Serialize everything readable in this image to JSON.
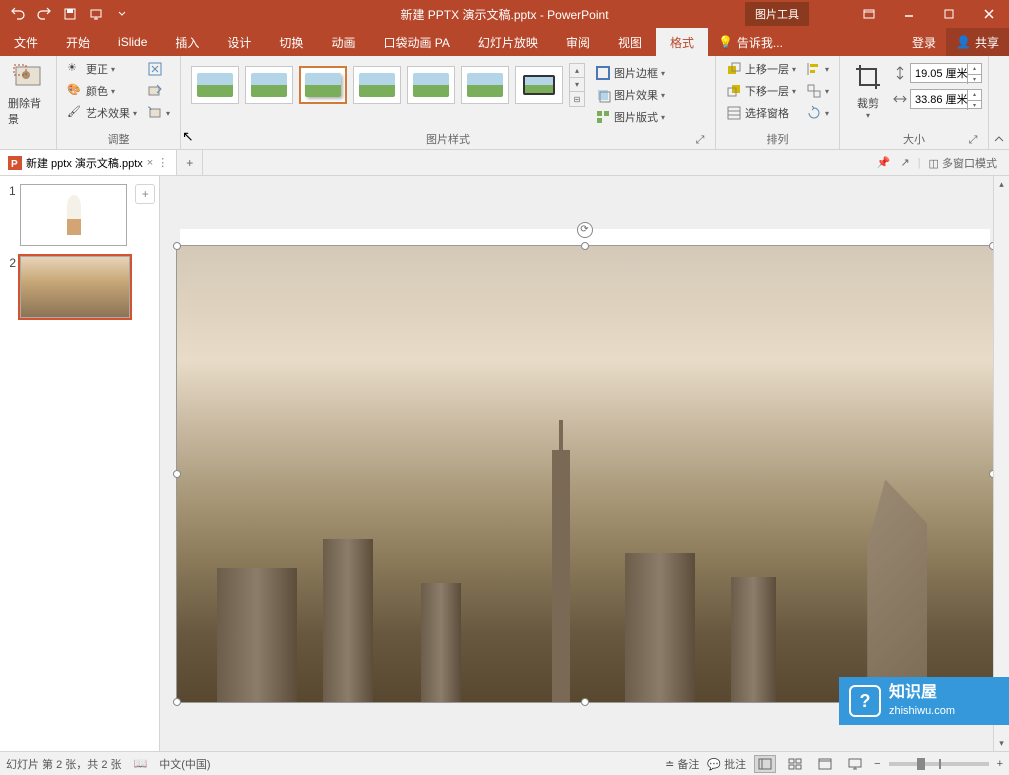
{
  "title": "新建 PPTX 演示文稿.pptx - PowerPoint",
  "contextual_tab": "图片工具",
  "window": {
    "login": "登录",
    "share": "共享"
  },
  "tabs": [
    "文件",
    "开始",
    "iSlide",
    "插入",
    "设计",
    "切换",
    "动画",
    "口袋动画 PA",
    "幻灯片放映",
    "审阅",
    "视图",
    "格式"
  ],
  "tell_me": "告诉我...",
  "ribbon": {
    "remove_bg": "删除背景",
    "adjust_group": "调整",
    "corrections": "更正",
    "color": "颜色",
    "artistic": "艺术效果",
    "styles_group": "图片样式",
    "border": "图片边框",
    "effects": "图片效果",
    "layout": "图片版式",
    "arrange_group": "排列",
    "bring_fwd": "上移一层",
    "send_back": "下移一层",
    "selection_pane": "选择窗格",
    "size_group": "大小",
    "crop": "裁剪",
    "height": "19.05 厘米",
    "width": "33.86 厘米"
  },
  "doc_tab": {
    "name": "新建 pptx 演示文稿.pptx",
    "close": "×"
  },
  "multi_window": "多窗口模式",
  "slides": {
    "s1": "1",
    "s2": "2"
  },
  "status": {
    "slide_info": "幻灯片 第 2 张，共 2 张",
    "lang": "中文(中国)",
    "notes": "备注",
    "comments": "批注"
  },
  "watermark": {
    "cn": "知识屋",
    "url": "zhishiwu.com"
  }
}
